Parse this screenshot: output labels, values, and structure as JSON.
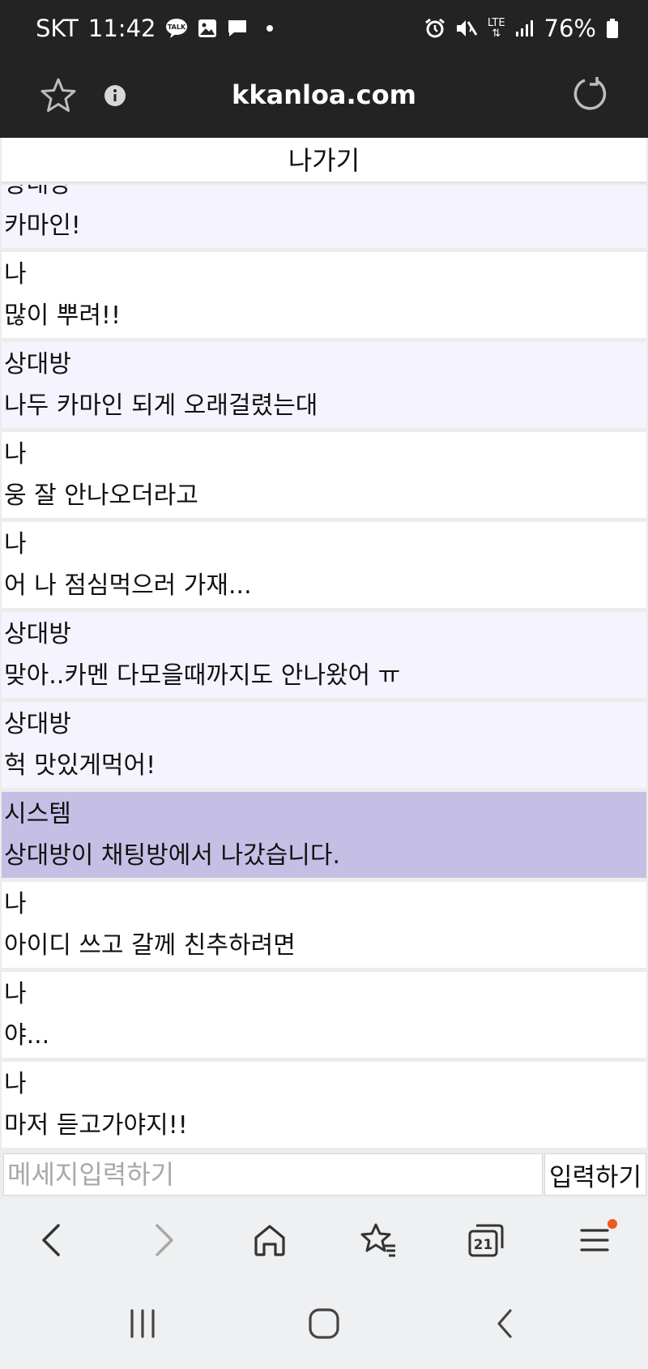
{
  "status_bar": {
    "carrier": "SKT",
    "time": "11:42",
    "talk_badge": "TALK",
    "network": "LTE",
    "battery": "76%"
  },
  "browser": {
    "url": "kkanloa.com"
  },
  "chat": {
    "exit_label": "나가기",
    "partial_top_sender": "상대방",
    "messages": [
      {
        "sender": "상대방",
        "text": "카마인!",
        "kind": "other"
      },
      {
        "sender": "나",
        "text": "많이 뿌려!!",
        "kind": "mine"
      },
      {
        "sender": "상대방",
        "text": "나두 카마인 되게 오래걸렸는대",
        "kind": "other"
      },
      {
        "sender": "나",
        "text": "웅 잘 안나오더라고",
        "kind": "mine"
      },
      {
        "sender": "나",
        "text": "어 나 점심먹으러 가재...",
        "kind": "mine"
      },
      {
        "sender": "상대방",
        "text": "맞아..카멘 다모을때까지도 안나왔어 ㅠ",
        "kind": "other"
      },
      {
        "sender": "상대방",
        "text": "헉 맛있게먹어!",
        "kind": "other"
      },
      {
        "sender": "시스템",
        "text": "상대방이 채팅방에서 나갔습니다.",
        "kind": "system"
      },
      {
        "sender": "나",
        "text": "아이디 쓰고 갈께 친추하려면",
        "kind": "mine"
      },
      {
        "sender": "나",
        "text": "야...",
        "kind": "mine"
      },
      {
        "sender": "나",
        "text": "마저 듣고가야지!!",
        "kind": "mine"
      }
    ],
    "input_placeholder": "메세지입력하기",
    "input_value": "",
    "send_label": "입력하기"
  },
  "bottom_nav": {
    "tabs_count": "21"
  },
  "colors": {
    "status_bg": "#232323",
    "other_bg": "#f5f3fd",
    "system_bg": "#c6bfe5",
    "menu_badge": "#ef5a1e",
    "nav_icon": "#333333"
  },
  "icons": {
    "status": [
      "kakaotalk-icon",
      "gallery-icon",
      "message-icon",
      "dot-icon",
      "alarm-icon",
      "mute-icon",
      "signal-icon",
      "battery-icon"
    ],
    "browser": [
      "star-icon",
      "info-icon",
      "reload-icon"
    ],
    "nav": [
      "back-icon",
      "forward-icon",
      "home-icon",
      "bookmarks-icon",
      "tabs-icon",
      "menu-icon"
    ],
    "system": [
      "recent-apps-icon",
      "home-circle-icon",
      "system-back-icon"
    ]
  }
}
